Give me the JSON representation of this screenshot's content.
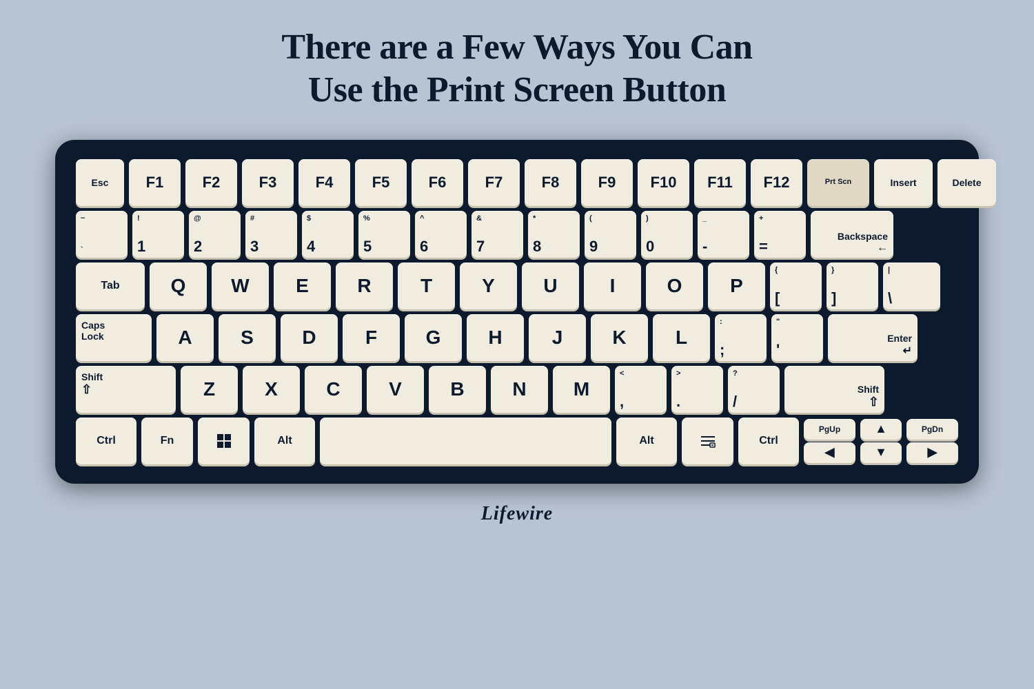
{
  "title": {
    "line1": "There are a Few Ways You Can",
    "line2": "Use the Print Screen Button"
  },
  "brand": "Lifewire",
  "keyboard": {
    "rows": [
      {
        "id": "function-row",
        "keys": [
          {
            "id": "esc",
            "label": "Esc"
          },
          {
            "id": "f1",
            "label": "F1"
          },
          {
            "id": "f2",
            "label": "F2"
          },
          {
            "id": "f3",
            "label": "F3"
          },
          {
            "id": "f4",
            "label": "F4"
          },
          {
            "id": "f5",
            "label": "F5"
          },
          {
            "id": "f6",
            "label": "F6"
          },
          {
            "id": "f7",
            "label": "F7"
          },
          {
            "id": "f8",
            "label": "F8"
          },
          {
            "id": "f9",
            "label": "F9"
          },
          {
            "id": "f10",
            "label": "F10"
          },
          {
            "id": "f11",
            "label": "F11"
          },
          {
            "id": "f12",
            "label": "F12"
          },
          {
            "id": "prtscn",
            "label": "Prt Scn"
          },
          {
            "id": "insert",
            "label": "Insert"
          },
          {
            "id": "delete",
            "label": "Delete"
          }
        ]
      }
    ]
  }
}
